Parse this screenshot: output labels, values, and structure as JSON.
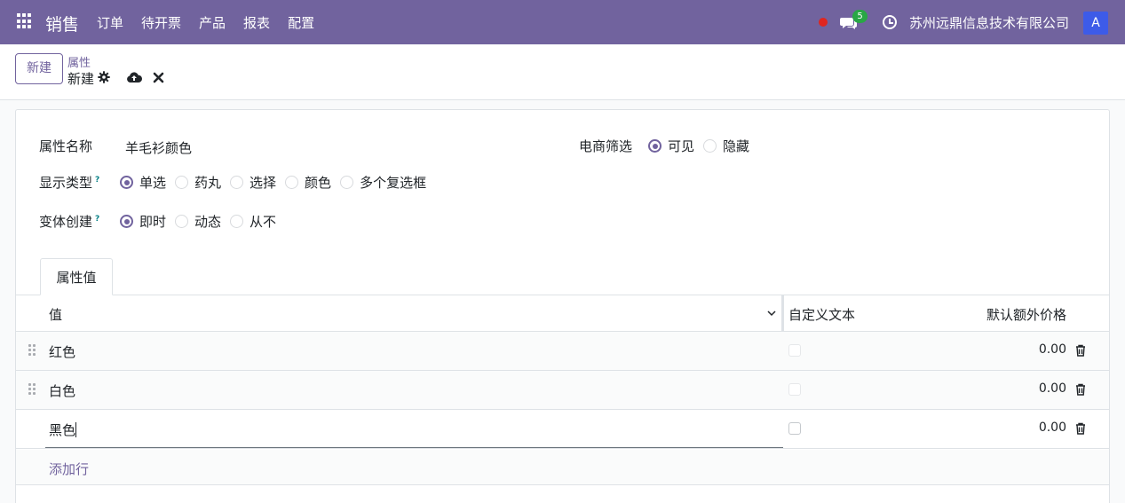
{
  "navbar": {
    "app_name": "销售",
    "menu": [
      "订单",
      "待开票",
      "产品",
      "报表",
      "配置"
    ],
    "message_count": "5",
    "company": "苏州远鼎信息技术有限公司",
    "avatar_letter": "A",
    "colors": {
      "bar": "#71639e",
      "avatar": "#3d5be8",
      "badge": "#28a745",
      "recording": "#e0261f"
    }
  },
  "control": {
    "new_label": "新建",
    "breadcrumb_parent": "属性",
    "breadcrumb_current": "新建"
  },
  "form": {
    "name_label": "属性名称",
    "name_value": "羊毛衫颜色",
    "ecommerce_label": "电商筛选",
    "ecommerce_options": [
      "可见",
      "隐藏"
    ],
    "ecommerce_selected": "可见",
    "display_label": "显示类型",
    "display_options": [
      "单选",
      "药丸",
      "选择",
      "颜色",
      "多个复选框"
    ],
    "display_selected": "单选",
    "variant_label": "变体创建",
    "variant_options": [
      "即时",
      "动态",
      "从不"
    ],
    "variant_selected": "即时",
    "help_mark": "?"
  },
  "tab": {
    "label": "属性值"
  },
  "table": {
    "headers": {
      "value": "值",
      "custom_text": "自定义文本",
      "extra_price": "默认额外价格"
    },
    "rows": [
      {
        "name": "红色",
        "price": "0.00"
      },
      {
        "name": "白色",
        "price": "0.00"
      },
      {
        "name": "黑色",
        "price": "0.00"
      }
    ],
    "add_line": "添加行"
  },
  "icons": [
    "apps-grid-icon",
    "chat-icon",
    "clock-icon",
    "gear-icon",
    "cloud-upload-icon",
    "close-icon",
    "chevron-down-icon",
    "drag-handle-icon",
    "trash-icon"
  ]
}
